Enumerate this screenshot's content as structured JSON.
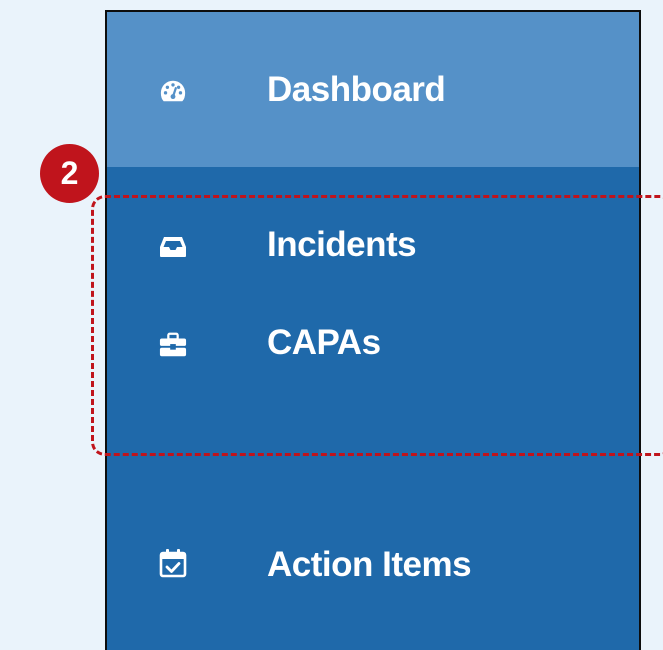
{
  "sidebar": {
    "items": [
      {
        "label": "Dashboard",
        "icon": "gauge-icon",
        "active": true
      },
      {
        "label": "Incidents",
        "icon": "inbox-icon",
        "active": false
      },
      {
        "label": "CAPAs",
        "icon": "toolbox-icon",
        "active": false
      },
      {
        "label": "Action Items",
        "icon": "calendar-check-icon",
        "active": false
      }
    ]
  },
  "annotation": {
    "step_number": "2",
    "highlight_color": "#c0141c"
  },
  "colors": {
    "sidebar_bg": "#1f69aa",
    "active_item_bg": "#5591c8",
    "page_bg": "#eaf3fb",
    "label_color": "#ffffff"
  }
}
